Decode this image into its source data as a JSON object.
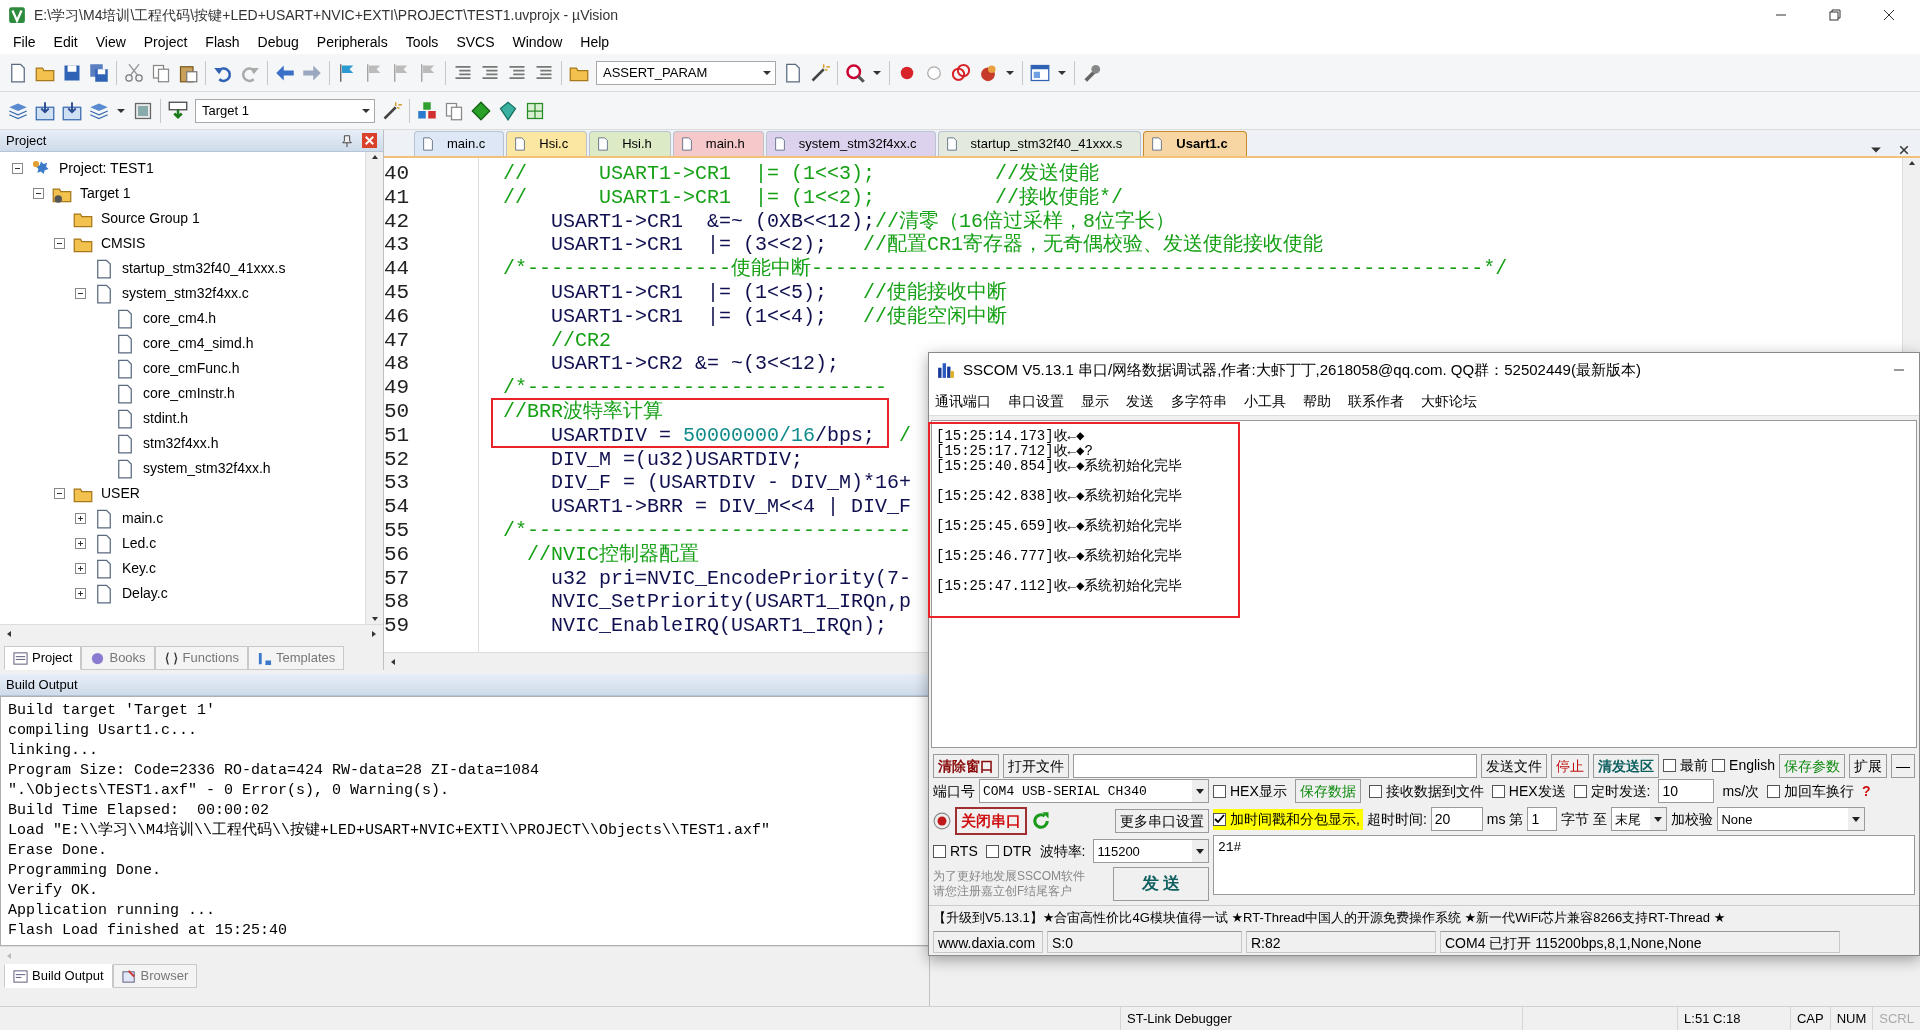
{
  "window": {
    "title": "E:\\学习\\M4培训\\工程代码\\按键+LED+USART+NVIC+EXTI\\PROJECT\\TEST1.uvprojx - µVision"
  },
  "menu": [
    "File",
    "Edit",
    "View",
    "Project",
    "Flash",
    "Debug",
    "Peripherals",
    "Tools",
    "SVCS",
    "Window",
    "Help"
  ],
  "toolbar": {
    "find_combo": "ASSERT_PARAM",
    "target_combo": "Target 1"
  },
  "project_panel": {
    "title": "Project",
    "tree": [
      {
        "label": "Project: TEST1",
        "kind": "project",
        "expanded": true,
        "children": [
          {
            "label": "Target 1",
            "kind": "target",
            "expanded": true,
            "children": [
              {
                "label": "Source Group 1",
                "kind": "group"
              },
              {
                "label": "CMSIS",
                "kind": "group",
                "expanded": true,
                "children": [
                  {
                    "label": "startup_stm32f40_41xxx.s",
                    "kind": "file"
                  },
                  {
                    "label": "system_stm32f4xx.c",
                    "kind": "file",
                    "expanded": true,
                    "children": [
                      {
                        "label": "core_cm4.h",
                        "kind": "file"
                      },
                      {
                        "label": "core_cm4_simd.h",
                        "kind": "file"
                      },
                      {
                        "label": "core_cmFunc.h",
                        "kind": "file"
                      },
                      {
                        "label": "core_cmInstr.h",
                        "kind": "file"
                      },
                      {
                        "label": "stdint.h",
                        "kind": "file"
                      },
                      {
                        "label": "stm32f4xx.h",
                        "kind": "file"
                      },
                      {
                        "label": "system_stm32f4xx.h",
                        "kind": "file"
                      }
                    ]
                  }
                ]
              },
              {
                "label": "USER",
                "kind": "group",
                "expanded": true,
                "children": [
                  {
                    "label": "main.c",
                    "kind": "file",
                    "expanded": false
                  },
                  {
                    "label": "Led.c",
                    "kind": "file",
                    "expanded": false
                  },
                  {
                    "label": "Key.c",
                    "kind": "file",
                    "expanded": false
                  },
                  {
                    "label": "Delay.c",
                    "kind": "file",
                    "expanded": false
                  }
                ]
              }
            ]
          }
        ]
      }
    ],
    "tabs": [
      {
        "label": "Project",
        "selected": true
      },
      {
        "label": "Books",
        "selected": false
      },
      {
        "label": "Functions",
        "selected": false
      },
      {
        "label": "Templates",
        "selected": false
      }
    ]
  },
  "editor": {
    "tabs": [
      {
        "label": "main.c",
        "color": "#dde7f5",
        "selected": false
      },
      {
        "label": "Hsi.c",
        "color": "#fbe7a1",
        "selected": false
      },
      {
        "label": "Hsi.h",
        "color": "#dcebc6",
        "selected": false
      },
      {
        "label": "main.h",
        "color": "#f5c9c9",
        "selected": false
      },
      {
        "label": "system_stm32f4xx.c",
        "color": "#ddd2ee",
        "selected": false
      },
      {
        "label": "startup_stm32f40_41xxx.s",
        "color": "#e3e9dc",
        "selected": false
      },
      {
        "label": "Usart1.c",
        "color": "#f8d6a3",
        "selected": true
      }
    ],
    "lines": [
      {
        "number": "40",
        "segments": [
          {
            "kind": "comment",
            "text": "//      USART1->CR1  |= (1<<3);          //发送使能"
          }
        ]
      },
      {
        "number": "41",
        "segments": [
          {
            "kind": "comment",
            "text": "//      USART1->CR1  |= (1<<2);          //接收使能*/"
          }
        ]
      },
      {
        "number": "42",
        "segments": [
          {
            "kind": "code",
            "text": "    USART1->CR1  &=~ (0XB<<12);"
          },
          {
            "kind": "comment",
            "text": "//清零（16倍过采样，8位字长）"
          }
        ]
      },
      {
        "number": "43",
        "segments": [
          {
            "kind": "code",
            "text": "    USART1->CR1  |= (3<<2);"
          },
          {
            "kind": "comment",
            "text": "   //配置CR1寄存器，无奇偶校验、发送使能接收使能"
          }
        ]
      },
      {
        "number": "44",
        "segments": [
          {
            "kind": "comment",
            "text": "/*-----------------使能中断--------------------------------------------------------*/"
          }
        ]
      },
      {
        "number": "45",
        "segments": [
          {
            "kind": "code",
            "text": "    USART1->CR1  |= (1<<5);"
          },
          {
            "kind": "comment",
            "text": "   //使能接收中断"
          }
        ]
      },
      {
        "number": "46",
        "segments": [
          {
            "kind": "code",
            "text": "    USART1->CR1  |= (1<<4);"
          },
          {
            "kind": "comment",
            "text": "   //使能空闲中断"
          }
        ]
      },
      {
        "number": "47",
        "segments": [
          {
            "kind": "comment",
            "text": "    //CR2"
          }
        ]
      },
      {
        "number": "48",
        "segments": [
          {
            "kind": "code",
            "text": "    USART1->CR2 &= ~(3<<12);"
          }
        ]
      },
      {
        "number": "49",
        "segments": [
          {
            "kind": "comment",
            "text": "/*------------------------------"
          }
        ]
      },
      {
        "number": "50",
        "segments": [
          {
            "kind": "comment",
            "text": "//BRR波特率计算"
          }
        ]
      },
      {
        "number": "51",
        "segments": [
          {
            "kind": "code",
            "text": "    USARTDIV = "
          },
          {
            "kind": "number",
            "text": "50000000/16"
          },
          {
            "kind": "code",
            "text": "/bps;"
          },
          {
            "kind": "comment",
            "text": "  /"
          }
        ]
      },
      {
        "number": "52",
        "segments": [
          {
            "kind": "code",
            "text": "    DIV_M =(u32)USARTDIV;"
          }
        ]
      },
      {
        "number": "53",
        "segments": [
          {
            "kind": "code",
            "text": "    DIV_F = (USARTDIV - DIV_M)*16+"
          }
        ]
      },
      {
        "number": "54",
        "segments": [
          {
            "kind": "code",
            "text": "    USART1->BRR = DIV_M<<4 | DIV_F"
          }
        ]
      },
      {
        "number": "55",
        "segments": [
          {
            "kind": "comment",
            "text": "/*--------------------------------"
          }
        ]
      },
      {
        "number": "56",
        "segments": [
          {
            "kind": "comment",
            "text": "  //NVIC控制器配置"
          }
        ]
      },
      {
        "number": "57",
        "segments": [
          {
            "kind": "code",
            "text": "    u32 pri=NVIC_EncodePriority(7-"
          }
        ]
      },
      {
        "number": "58",
        "segments": [
          {
            "kind": "code",
            "text": "    NVIC_SetPriority(USART1_IRQn,p"
          }
        ]
      },
      {
        "number": "59",
        "segments": [
          {
            "kind": "code",
            "text": "    NVIC_EnableIRQ(USART1_IRQn);"
          }
        ]
      }
    ]
  },
  "build_output": {
    "title": "Build Output",
    "lines": [
      "Build target 'Target 1'",
      "compiling Usart1.c...",
      "linking...",
      "Program Size: Code=2336 RO-data=424 RW-data=28 ZI-data=1084",
      "\".\\Objects\\TEST1.axf\" - 0 Error(s), 0 Warning(s).",
      "Build Time Elapsed:  00:00:02",
      "Load \"E:\\\\学习\\\\M4培训\\\\工程代码\\\\按键+LED+USART+NVIC+EXTI\\\\PROJECT\\\\Objects\\\\TEST1.axf\"",
      "Erase Done.",
      "Programming Done.",
      "Verify OK.",
      "Application running ...",
      "Flash Load finished at 15:25:40"
    ],
    "tabs": [
      {
        "label": "Build Output",
        "selected": true
      },
      {
        "label": "Browser",
        "selected": false
      }
    ]
  },
  "sscom": {
    "title": "SSCOM V5.13.1 串口/网络数据调试器,作者:大虾丁丁,2618058@qq.com. QQ群：52502449(最新版本)",
    "menu": [
      "通讯端口",
      "串口设置",
      "显示",
      "发送",
      "多字符串",
      "小工具",
      "帮助",
      "联系作者",
      "大虾论坛"
    ],
    "receive_lines": [
      "[15:25:14.173]收←◆",
      "[15:25:17.712]收←◆?",
      "[15:25:40.854]收←◆系统初始化完毕\n",
      "[15:25:42.838]收←◆系统初始化完毕\n",
      "[15:25:45.659]收←◆系统初始化完毕\n",
      "[15:25:46.777]收←◆系统初始化完毕\n",
      "[15:25:47.112]收←◆系统初始化完毕"
    ],
    "controls": {
      "clear_button": "清除窗口",
      "open_file_button": "打开文件",
      "send_file_button": "发送文件",
      "stop_button": "停止",
      "clear_send_button": "清发送区",
      "topmost": {
        "label": "最前",
        "checked": false
      },
      "english": {
        "label": "English",
        "checked": false
      },
      "save_params_button": "保存参数",
      "expand_button": "扩展",
      "collapse_button": "—",
      "port_label": "端口号",
      "port": "COM4 USB-SERIAL CH340",
      "hex_display": {
        "label": "HEX显示",
        "checked": false
      },
      "save_data_button": "保存数据",
      "receive_to_file": {
        "label": "接收数据到文件",
        "checked": false
      },
      "hex_send": {
        "label": "HEX发送",
        "checked": false
      },
      "timed_send": {
        "label": "定时发送:",
        "checked": false
      },
      "interval": "10",
      "interval_unit": "ms/次",
      "append_newline": {
        "label": "加回车换行",
        "checked": false
      },
      "help_mark": "?",
      "close_port_button": "关闭串口",
      "more_settings_button": "更多串口设置",
      "timestamp": {
        "label": "加时间戳和分包显示,",
        "checked": true
      },
      "timeout_label": "超时时间:",
      "timeout": "20",
      "timeout_unit": "ms",
      "byte_from_label": "第",
      "byte_from": "1",
      "byte_label": "字节",
      "to_label": "至",
      "byte_to": "末尾",
      "checksum_label": "加校验",
      "checksum": "None",
      "rts": {
        "label": "RTS",
        "checked": false
      },
      "dtr": {
        "label": "DTR",
        "checked": false
      },
      "baud_label": "波特率:",
      "baud": "115200",
      "send_text": "21#",
      "promo": [
        "为了更好地发展SSCOM软件",
        "请您注册嘉立创F结尾客户"
      ],
      "send_button": "发 送"
    },
    "ticker": "【升级到V5.13.1】★合宙高性价比4G模块值得一试 ★RT-Thread中国人的开源免费操作系统 ★新一代WiFi芯片兼容8266支持RT-Thread ★",
    "status": [
      "www.daxia.com",
      "S:0",
      "R:82",
      "COM4 已打开  115200bps,8,1,None,None"
    ]
  },
  "status_bar": {
    "debugger": "ST-Link Debugger",
    "position": "L:51 C:18",
    "indicators": [
      {
        "label": "CAP",
        "on": true
      },
      {
        "label": "NUM",
        "on": true
      },
      {
        "label": "SCRL",
        "on": false
      }
    ]
  }
}
